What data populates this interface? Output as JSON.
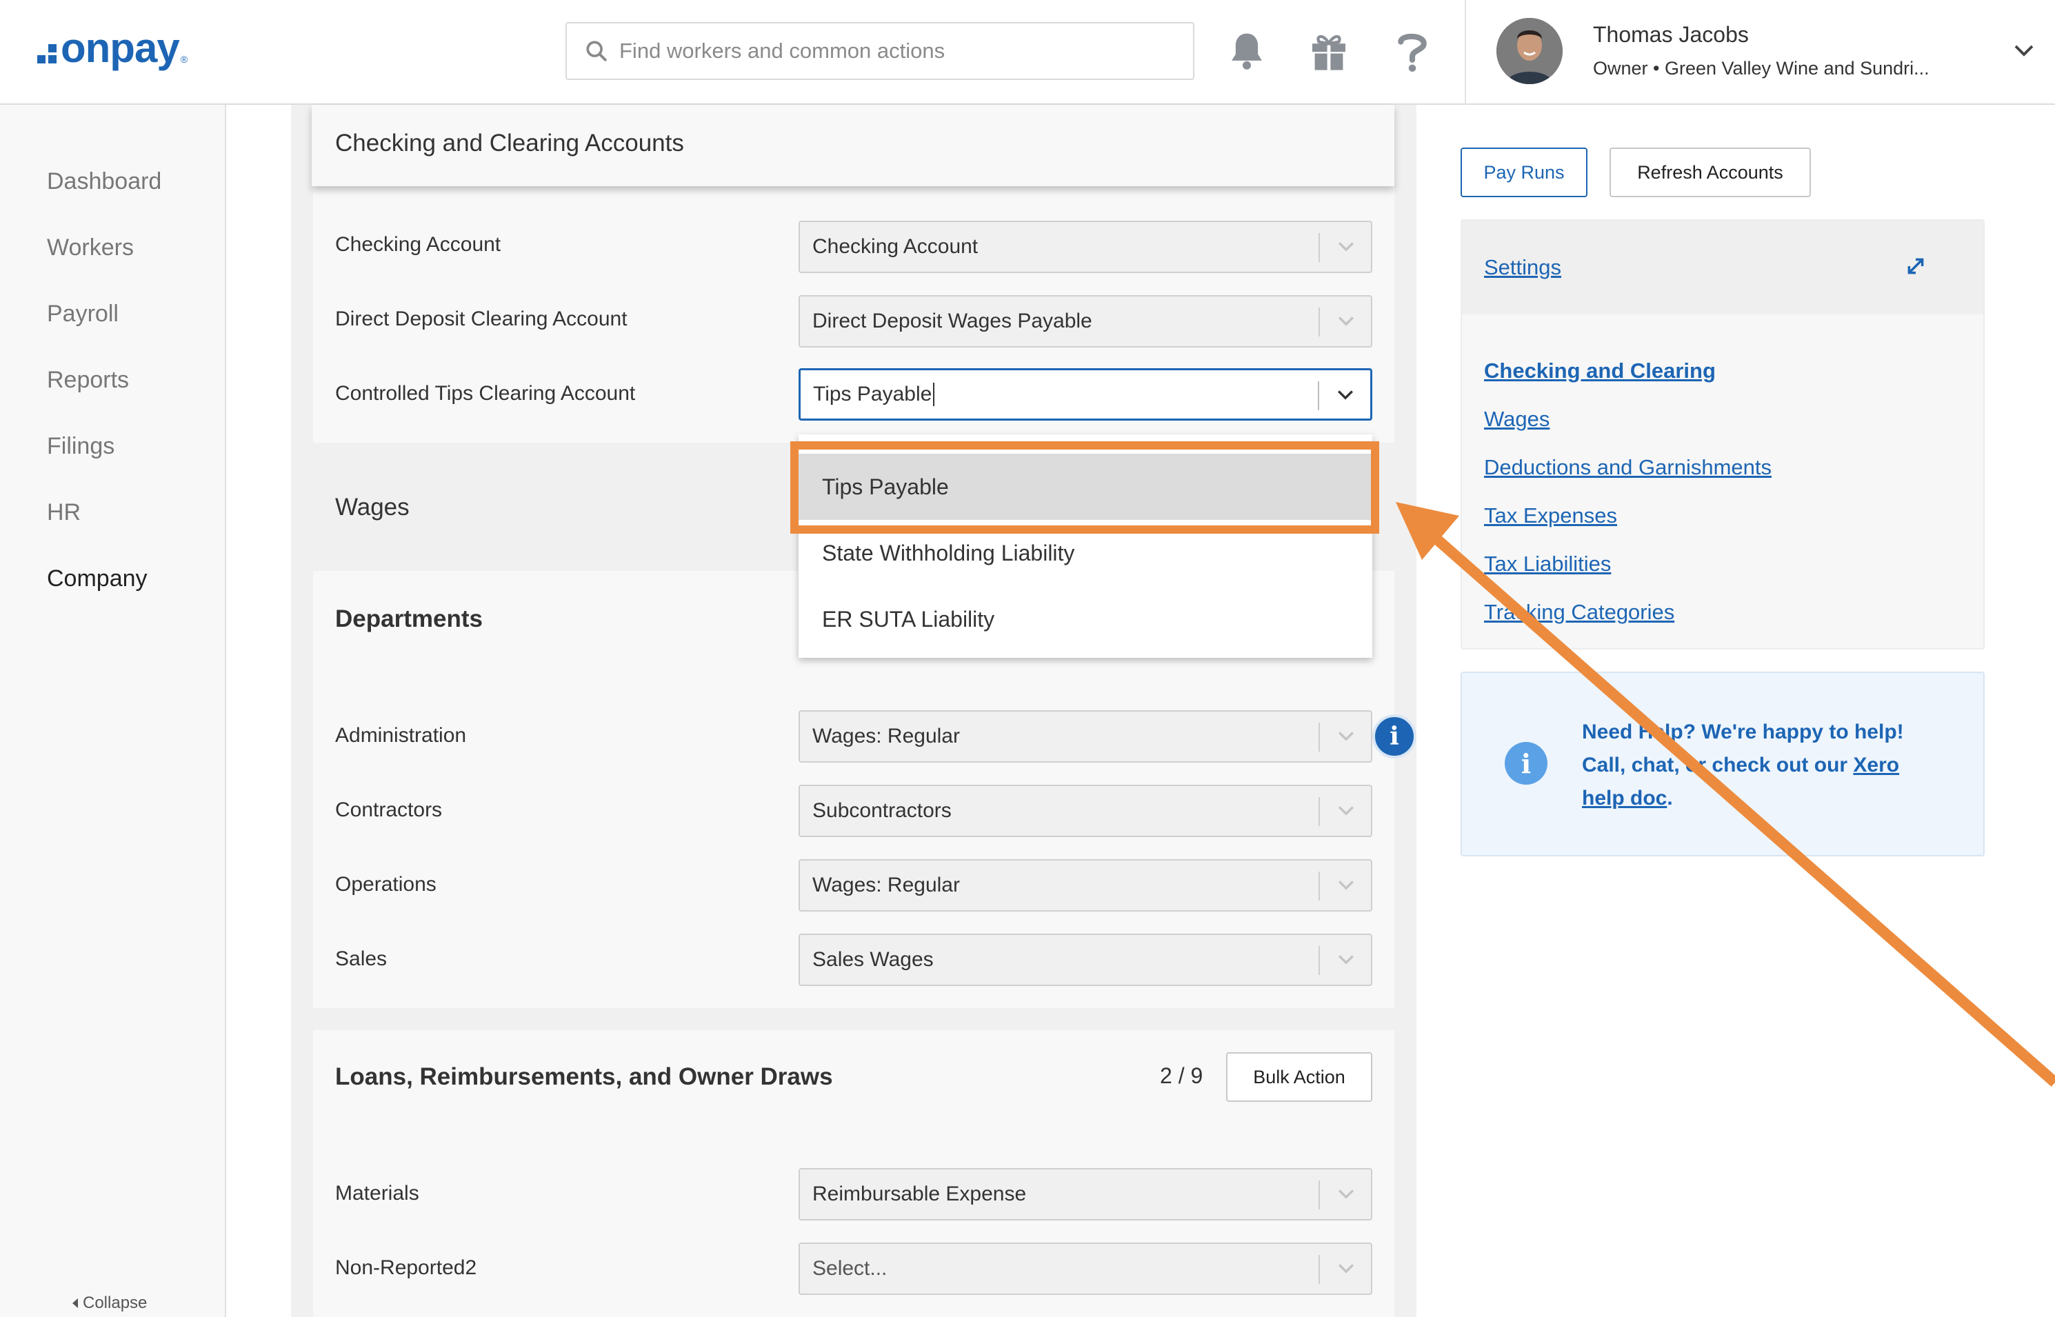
{
  "header": {
    "logo_text": "onpay",
    "logo_mark": "®",
    "search_placeholder": "Find workers and common actions",
    "icons": [
      "bell-icon",
      "gift-icon",
      "help-icon"
    ],
    "user_name": "Thomas Jacobs",
    "user_role": "Owner • Green Valley Wine and Sundri..."
  },
  "sidebar": {
    "items": [
      {
        "label": "Dashboard",
        "active": false
      },
      {
        "label": "Workers",
        "active": false
      },
      {
        "label": "Payroll",
        "active": false
      },
      {
        "label": "Reports",
        "active": false
      },
      {
        "label": "Filings",
        "active": false
      },
      {
        "label": "HR",
        "active": false
      },
      {
        "label": "Company",
        "active": true
      }
    ],
    "collapse_label": "Collapse"
  },
  "main": {
    "checking_section": {
      "title": "Checking and Clearing Accounts",
      "rows": [
        {
          "label": "Checking Account",
          "value": "Checking Account"
        },
        {
          "label": "Direct Deposit Clearing Account",
          "value": "Direct Deposit Wages Payable"
        },
        {
          "label": "Controlled Tips Clearing Account",
          "value": "Tips Payable"
        }
      ]
    },
    "dropdown_options": [
      "Tips Payable",
      "State Withholding Liability",
      "ER SUTA Liability"
    ],
    "wages_title": "Wages",
    "departments": {
      "title": "Departments",
      "rows": [
        {
          "label": "Administration",
          "value": "Wages: Regular"
        },
        {
          "label": "Contractors",
          "value": "Subcontractors"
        },
        {
          "label": "Operations",
          "value": "Wages: Regular"
        },
        {
          "label": "Sales",
          "value": "Sales Wages"
        }
      ]
    },
    "loans": {
      "title": "Loans, Reimbursements, and Owner Draws",
      "counter": "2 / 9",
      "bulk_action_label": "Bulk Action",
      "rows": [
        {
          "label": "Materials",
          "value": "Reimbursable Expense"
        },
        {
          "label": "Non-Reported2",
          "value": "Select..."
        }
      ]
    }
  },
  "right_panel": {
    "pay_runs_label": "Pay Runs",
    "refresh_label": "Refresh Accounts",
    "settings_label": "Settings",
    "links": [
      "Checking and Clearing",
      "Wages",
      "Deductions and Garnishments",
      "Tax Expenses",
      "Tax Liabilities",
      "Tracking Categories"
    ],
    "help": {
      "text": "Need Help? We're happy to help! Call, chat, or check out our ",
      "link_text": "Xero help doc",
      "suffix": "."
    }
  },
  "colors": {
    "brand_blue": "#1d65b4",
    "annotation_orange": "#ec8b3e"
  }
}
